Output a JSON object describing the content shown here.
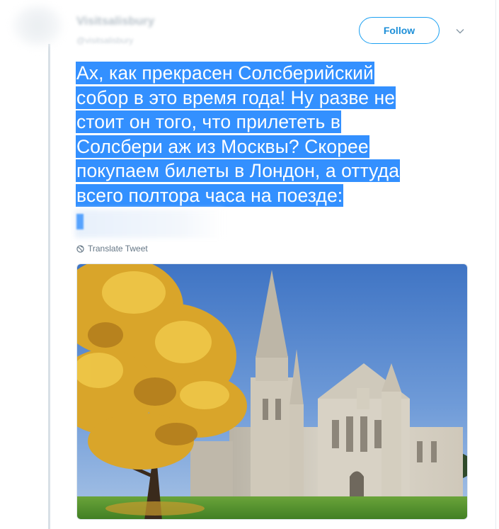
{
  "header": {
    "display_name": "Visitsalisbury",
    "handle": "@visitsalisbury"
  },
  "actions": {
    "follow_label": "Follow",
    "menu_icon": "chevron-down-icon"
  },
  "tweet": {
    "lines": [
      "Ах, как прекрасен Солсберийский",
      "собор в это время года! Ну разве не",
      "стоит он того, что прилететь в",
      "Солсбери аж из Москвы? Скорее",
      "покупаем билеты в Лондон, а оттуда",
      "всего полтора часа на поезде:"
    ],
    "translate_label": "Translate Tweet"
  },
  "colors": {
    "accent": "#1da1f2",
    "selection": "#3390ff",
    "muted": "#657786"
  }
}
